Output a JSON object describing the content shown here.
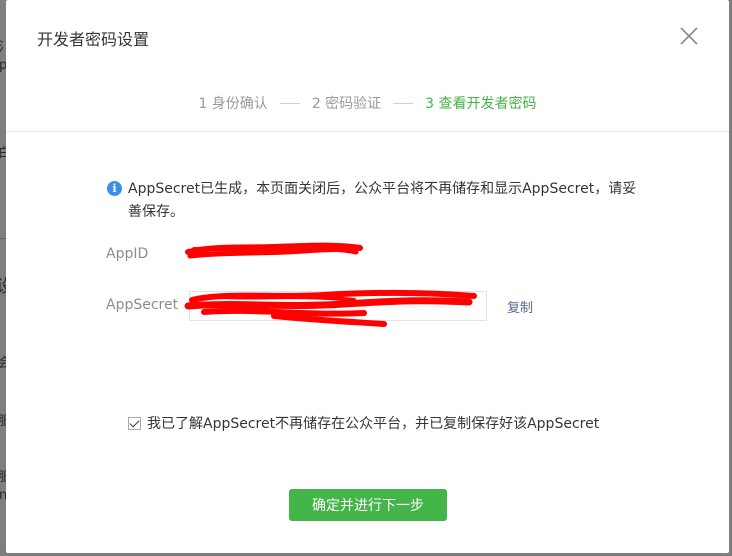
{
  "dialog": {
    "title": "开发者密码设置",
    "close_icon": "close-icon"
  },
  "steps": [
    {
      "label": "1 身份确认",
      "state": "done"
    },
    {
      "label": "2 密码验证",
      "state": "done"
    },
    {
      "label": "3 查看开发者密码",
      "state": "active"
    }
  ],
  "notice": {
    "icon": "info-icon",
    "text": "AppSecret已生成，本页面关闭后，公众平台将不再储存和显示AppSecret，请妥善保存。"
  },
  "fields": {
    "appid_label": "AppID",
    "secret_label": "AppSecret",
    "copy_label": "复制"
  },
  "confirm": {
    "checked": true,
    "label": "我已了解AppSecret不再储存在公众平台，并已复制保存好该AppSecret"
  },
  "next_button": "确定并进行下一步",
  "colors": {
    "accent_green": "#44b549",
    "link_blue": "#576b95",
    "info_blue": "#3d8ee8",
    "redaction_red": "#ff0000"
  }
}
